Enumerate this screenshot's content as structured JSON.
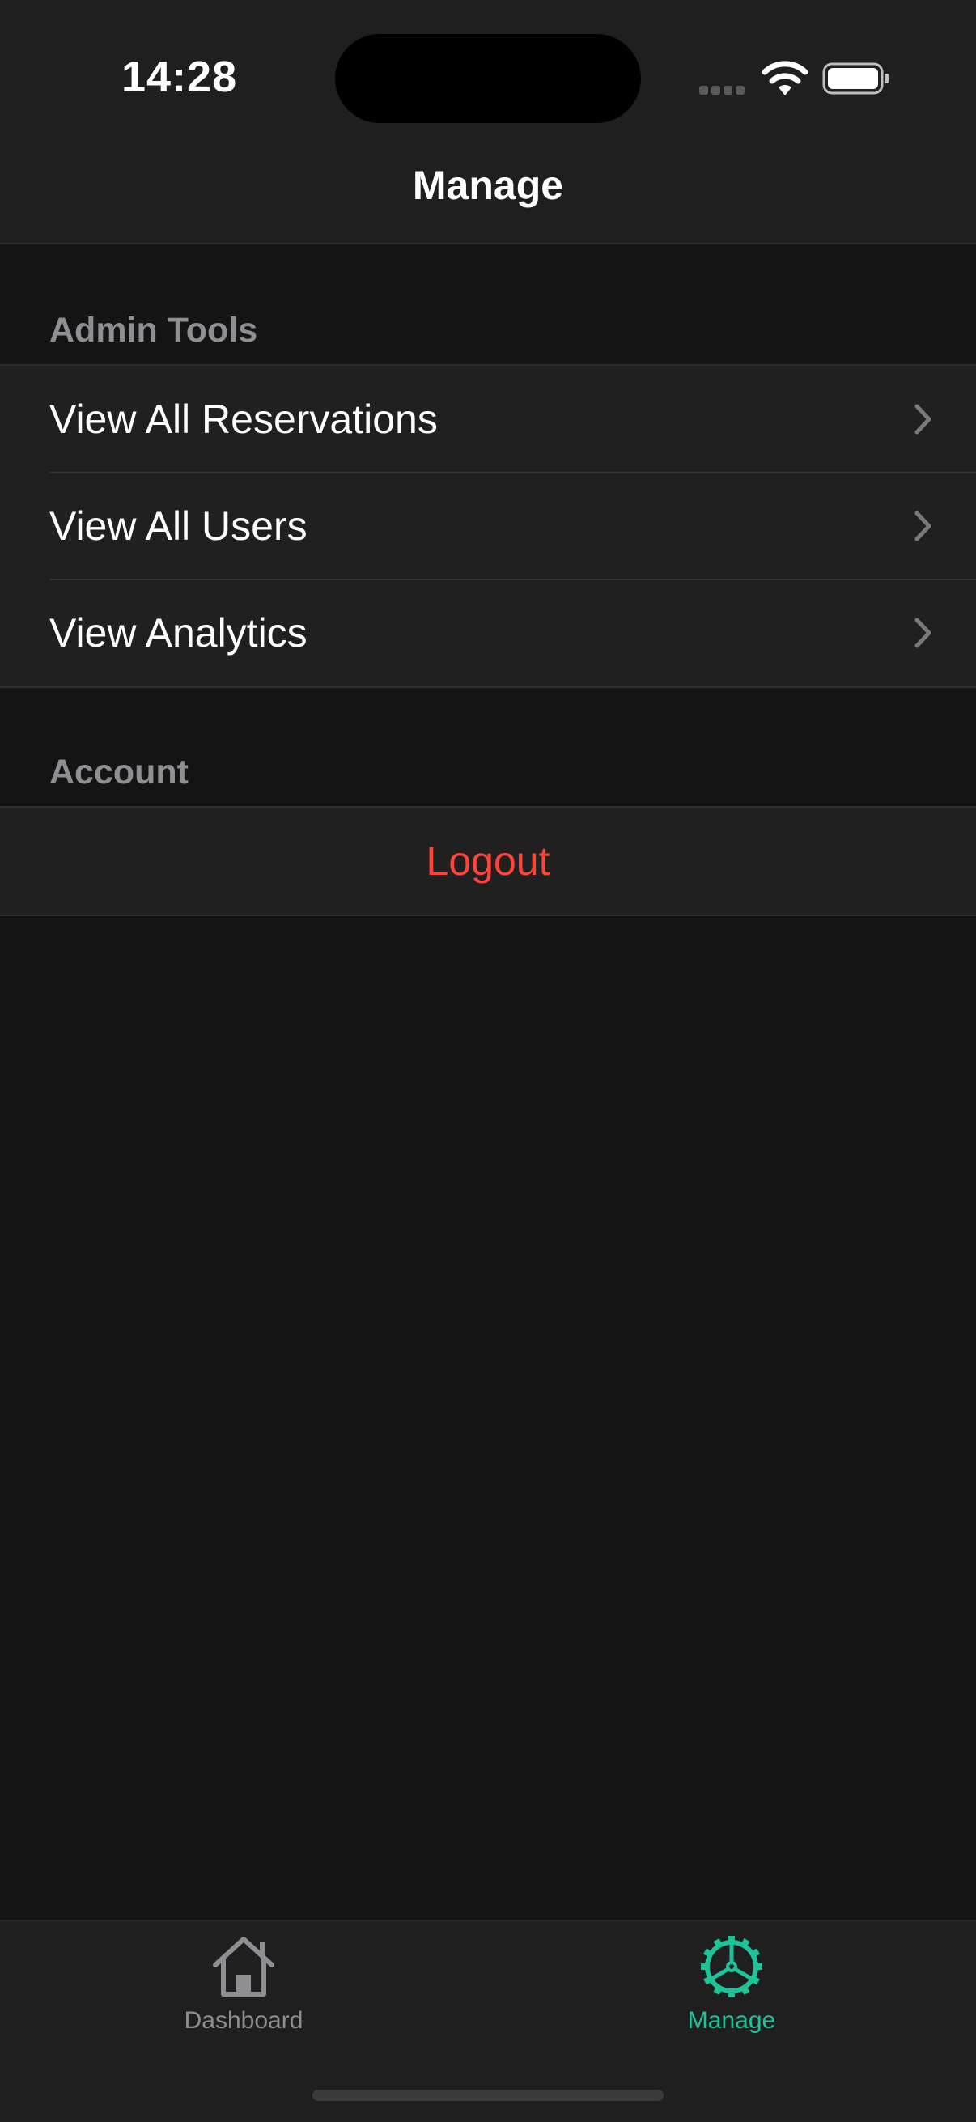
{
  "status_bar": {
    "time": "14:28"
  },
  "nav": {
    "title": "Manage"
  },
  "sections": {
    "admin_tools": {
      "header": "Admin Tools",
      "items": [
        {
          "label": "View All Reservations",
          "icon": "chevron-right-icon"
        },
        {
          "label": "View All Users",
          "icon": "chevron-right-icon"
        },
        {
          "label": "View Analytics",
          "icon": "chevron-right-icon"
        }
      ]
    },
    "account": {
      "header": "Account",
      "logout_label": "Logout"
    }
  },
  "tab_bar": {
    "tabs": [
      {
        "label": "Dashboard",
        "icon": "house-icon",
        "active": false
      },
      {
        "label": "Manage",
        "icon": "gear-icon",
        "active": true
      }
    ]
  },
  "colors": {
    "background": "#141414",
    "surface": "#202020",
    "accent": "#1fc39a",
    "destructive": "#ff453a",
    "secondary_text": "#8e8e93"
  }
}
